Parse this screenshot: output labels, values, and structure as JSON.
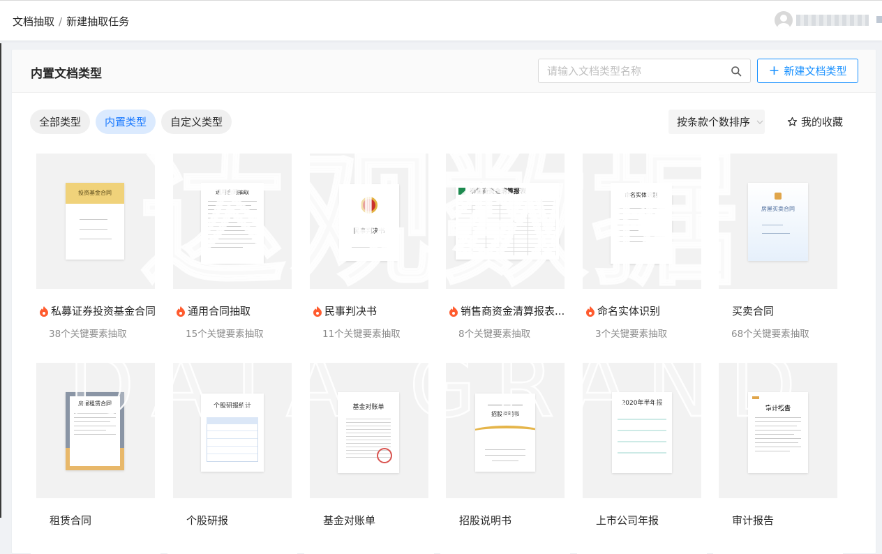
{
  "breadcrumb": {
    "root": "文档抽取",
    "separator": "/",
    "current": "新建抽取任务"
  },
  "panel": {
    "title": "内置文档类型",
    "search_placeholder": "请输入文档类型名称",
    "new_button": "新建文档类型",
    "new_button_icon": "+"
  },
  "filters": [
    {
      "label": "全部类型",
      "active": false
    },
    {
      "label": "内置类型",
      "active": true
    },
    {
      "label": "自定义类型",
      "active": false
    }
  ],
  "sort": {
    "label": "按条款个数排序"
  },
  "favorites": {
    "label": "我的收藏"
  },
  "cards": [
    {
      "title": "私募证券投资基金合同",
      "subtitle": "38个关键要素抽取",
      "hot": true,
      "thumb_title": "投资基金合同"
    },
    {
      "title": "通用合同抽取",
      "subtitle": "15个关键要素抽取",
      "hot": true,
      "thumb_title": "通用合同抽取"
    },
    {
      "title": "民事判决书",
      "subtitle": "11个关键要素抽取",
      "hot": true,
      "thumb_title": "民事判决书"
    },
    {
      "title": "销售商资金清算报表...",
      "subtitle": "8个关键要素抽取",
      "hot": true,
      "thumb_title": "销售商资金清算报表"
    },
    {
      "title": "命名实体识别",
      "subtitle": "3个关键要素抽取",
      "hot": true,
      "thumb_title": "命名实体识别"
    },
    {
      "title": "买卖合同",
      "subtitle": "68个关键要素抽取",
      "hot": false,
      "thumb_title": "房屋买卖合同"
    },
    {
      "title": "租赁合同",
      "subtitle": "",
      "hot": false,
      "thumb_title": "房屋租赁合同"
    },
    {
      "title": "个股研报",
      "subtitle": "",
      "hot": false,
      "thumb_title": "个股研报统计"
    },
    {
      "title": "基金对账单",
      "subtitle": "",
      "hot": false,
      "thumb_title": "基金对账单"
    },
    {
      "title": "招股说明书",
      "subtitle": "",
      "hot": false,
      "thumb_title": "招股说明书"
    },
    {
      "title": "上市公司年报",
      "subtitle": "",
      "hot": false,
      "thumb_title": "2020年半年报"
    },
    {
      "title": "审计报告",
      "subtitle": "",
      "hot": false,
      "thumb_title": "审计报告"
    }
  ],
  "watermark": {
    "line1": "达观数据",
    "line2": "DATA GRAND"
  },
  "colors": {
    "primary": "#1890ff",
    "hot": "#ff5b2e",
    "active_pill_bg": "#dbeafe"
  }
}
